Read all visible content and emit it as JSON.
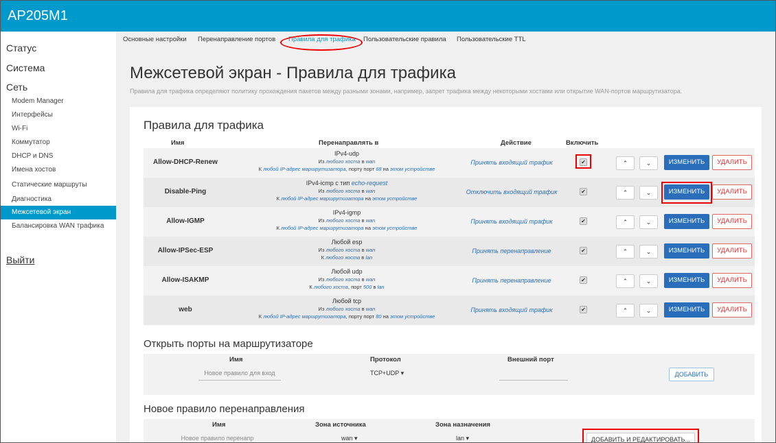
{
  "app": {
    "title": "AP205M1"
  },
  "sidebar": {
    "top": [
      {
        "label": "Статус"
      },
      {
        "label": "Система"
      },
      {
        "label": "Сеть"
      }
    ],
    "items": [
      {
        "label": "Modem Manager"
      },
      {
        "label": "Интерфейсы"
      },
      {
        "label": "Wi-Fi"
      },
      {
        "label": "Коммутатор"
      },
      {
        "label": "DHCP и DNS"
      },
      {
        "label": "Имена хостов"
      },
      {
        "label": "Статические маршруты"
      },
      {
        "label": "Диагностика"
      },
      {
        "label": "Межсетевой экран",
        "active": true
      },
      {
        "label": "Балансировка WAN трафика"
      }
    ],
    "logout": "Выйти"
  },
  "tabs": [
    {
      "label": "Основные настройки"
    },
    {
      "label": "Перенаправление портов"
    },
    {
      "label": "Правила для трафика",
      "active": true
    },
    {
      "label": "Пользовательские правила"
    },
    {
      "label": "Пользовательские TTL"
    }
  ],
  "page": {
    "title": "Межсетевой экран - Правила для трафика",
    "description": "Правила для трафика определяют политику прохождения пакетов между разными зонами, например, запрет трафика между некоторыми хостами или открытие WAN-портов маршрутизатора."
  },
  "rules": {
    "title": "Правила для трафика",
    "headers": {
      "name": "Имя",
      "forward": "Перенаправлять в",
      "action": "Действие",
      "enable": "Включить"
    },
    "buttons": {
      "up": "⌃",
      "down": "⌄",
      "edit": "ИЗМЕНИТЬ",
      "delete": "УДАЛИТЬ"
    },
    "rows": [
      {
        "name": "Allow-DHCP-Renew",
        "l1": "IPv4-udp",
        "l2a": "Из ",
        "l2b": "любого хоста",
        "l2c": " в ",
        "l2d": "wan",
        "l3a": "К ",
        "l3b": "любой IP-адрес маршрутизатора",
        "l3c": ", порту порт ",
        "l3d": "68",
        "l3e": " на ",
        "l3f": "этом устройстве",
        "action": "Принять входящий трафик",
        "checked": "✔"
      },
      {
        "name": "Disable-Ping",
        "l1a": "IPv4-icmp с тип ",
        "l1b": "echo-request",
        "l2a": "Из ",
        "l2b": "любого хоста",
        "l2c": " в ",
        "l2d": "wan",
        "l3a": "К ",
        "l3b": "любой IP-адрес маршрутизатора",
        "l3c": " на ",
        "l3d": "этом устройстве",
        "action": "Отключить входящий трафик",
        "checked": "✔"
      },
      {
        "name": "Allow-IGMP",
        "l1": "IPv4-igmp",
        "l2a": "Из ",
        "l2b": "любого хоста",
        "l2c": " в ",
        "l2d": "wan",
        "l3a": "К ",
        "l3b": "любой IP-адрес маршрутизатора",
        "l3c": " на ",
        "l3d": "этом устройстве",
        "action": "Принять входящий трафик",
        "checked": "✔"
      },
      {
        "name": "Allow-IPSec-ESP",
        "l1": "Любой esp",
        "l2a": "Из ",
        "l2b": "любого хоста",
        "l2c": " в ",
        "l2d": "wan",
        "l3a": "К ",
        "l3b": "любого хоста",
        "l3c": " в ",
        "l3d": "lan",
        "action": "Принять перенаправление",
        "checked": "✔"
      },
      {
        "name": "Allow-ISAKMP",
        "l1": "Любой udp",
        "l2a": "Из ",
        "l2b": "любого хоста",
        "l2c": " в ",
        "l2d": "wan",
        "l3a": "К ",
        "l3b": "любого хоста",
        "l3c": ", порт ",
        "l3d": "500",
        "l3e": " в ",
        "l3f": "lan",
        "action": "Принять перенаправление",
        "checked": "✔"
      },
      {
        "name": "web",
        "l1": "Любой tcp",
        "l2a": "Из ",
        "l2b": "любого хоста",
        "l2c": " в ",
        "l2d": "wan",
        "l3a": "К ",
        "l3b": "любой IP-адрес маршрутизатора",
        "l3c": ", порту порт ",
        "l3d": "80",
        "l3e": " на ",
        "l3f": "этом устройстве",
        "action": "Принять входящий трафик",
        "checked": "✔"
      }
    ]
  },
  "open_ports": {
    "title": "Открыть порты на маршрутизаторе",
    "headers": {
      "name": "Имя",
      "protocol": "Протокол",
      "external_port": "Внешний порт"
    },
    "name_placeholder": "Новое правило для вход",
    "protocol_value": "TCP+UDP ▾",
    "add_button": "ДОБАВИТЬ"
  },
  "new_forward": {
    "title": "Новое правило перенаправления",
    "headers": {
      "name": "Имя",
      "src_zone": "Зона источника",
      "dst_zone": "Зона назначения"
    },
    "name_placeholder": "Новое правило перенапр",
    "src_value": "wan ▾",
    "dst_value": "lan ▾",
    "add_button": "ДОБАВИТЬ И РЕДАКТИРОВАТЬ..."
  }
}
